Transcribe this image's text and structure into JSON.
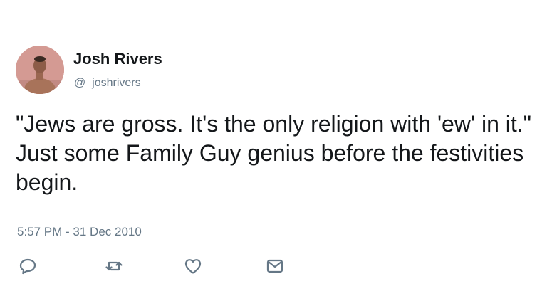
{
  "user": {
    "display_name": "Josh Rivers",
    "handle": "@_joshrivers",
    "avatar_icon": "profile-photo"
  },
  "tweet": {
    "text": "\"Jews are gross. It's the only religion with 'ew' in it.\" Just some Family Guy genius before the festivities begin.",
    "timestamp": "5:57 PM - 31 Dec 2010"
  },
  "actions": [
    {
      "name": "reply",
      "icon": "reply-icon"
    },
    {
      "name": "retweet",
      "icon": "retweet-icon"
    },
    {
      "name": "like",
      "icon": "heart-icon"
    },
    {
      "name": "direct-message",
      "icon": "envelope-icon"
    }
  ],
  "colors": {
    "text": "#14171a",
    "secondary": "#657786",
    "background": "#ffffff"
  }
}
